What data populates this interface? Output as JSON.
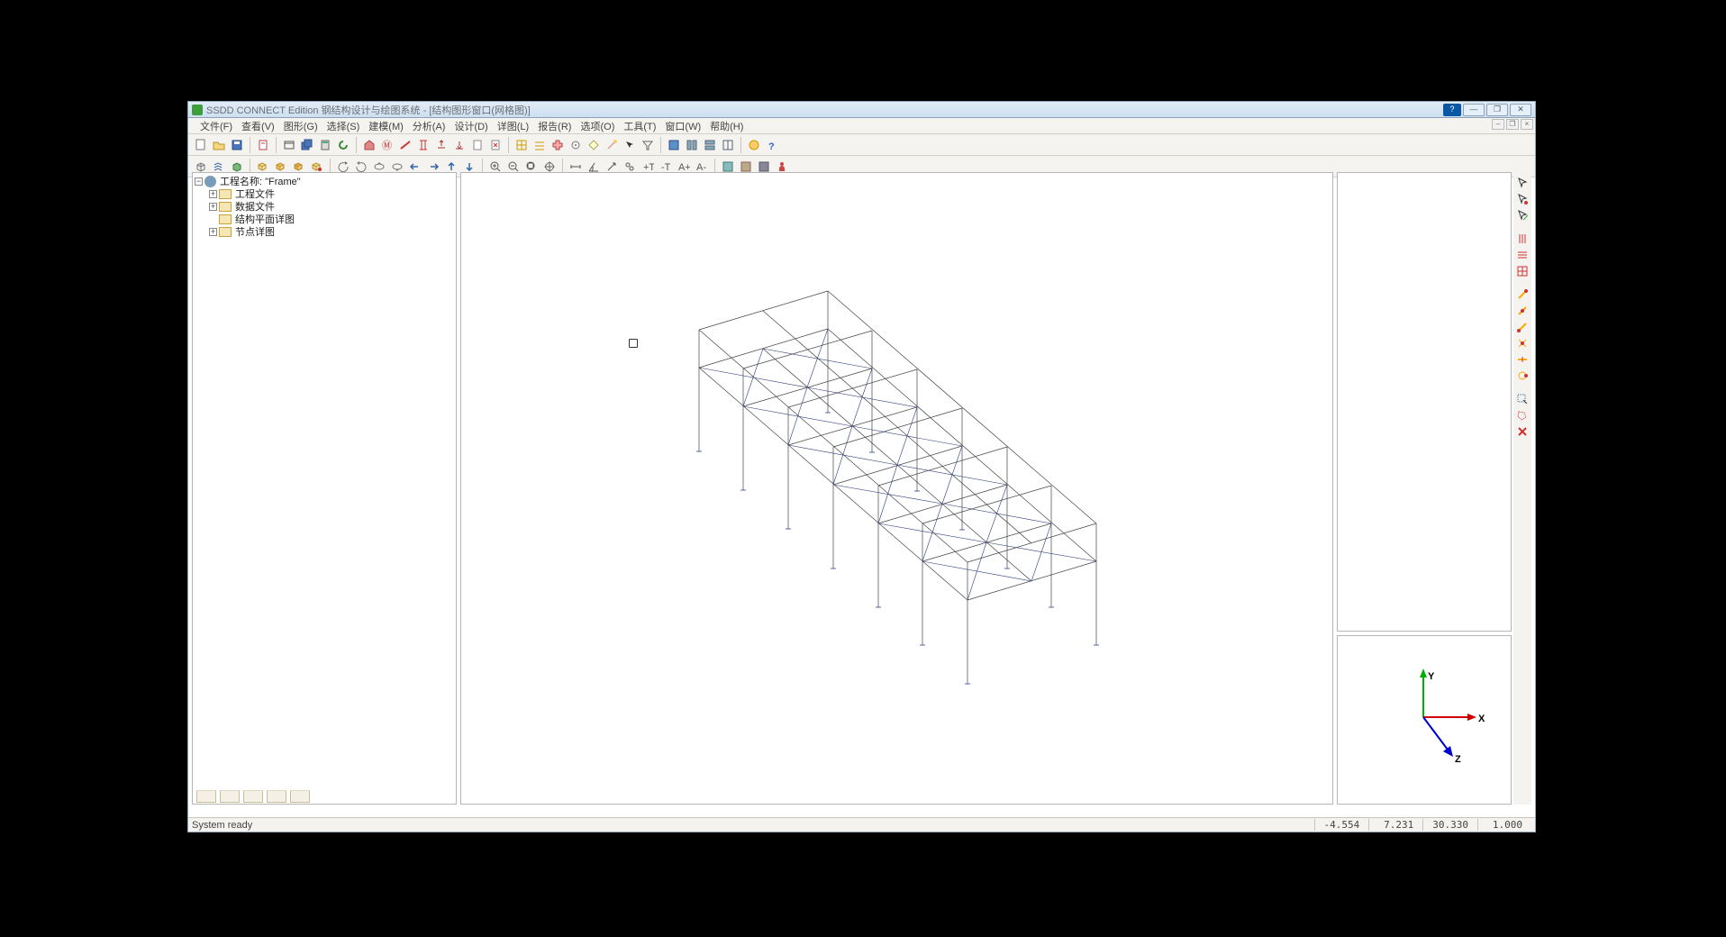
{
  "window": {
    "title": "SSDD CONNECT Edition 钢结构设计与绘图系统 - [结构图形窗口(网格图)]"
  },
  "menu": {
    "items": [
      "文件(F)",
      "查看(V)",
      "图形(G)",
      "选择(S)",
      "建模(M)",
      "分析(A)",
      "设计(D)",
      "详图(L)",
      "报告(R)",
      "选项(O)",
      "工具(T)",
      "窗口(W)",
      "帮助(H)"
    ]
  },
  "tree": {
    "root": "工程名称: \"Frame\"",
    "nodes": [
      {
        "label": "工程文件",
        "expandable": true,
        "indent": 1
      },
      {
        "label": "数据文件",
        "expandable": true,
        "indent": 1
      },
      {
        "label": "结构平面详图",
        "expandable": false,
        "indent": 1
      },
      {
        "label": "节点详图",
        "expandable": true,
        "indent": 1
      }
    ]
  },
  "status": {
    "msg": "System ready",
    "coord_x": "-4.554",
    "coord_y": "7.231",
    "coord_z": "30.330",
    "scale": "1.000"
  },
  "axes": {
    "x": "X",
    "y": "Y",
    "z": "Z"
  }
}
